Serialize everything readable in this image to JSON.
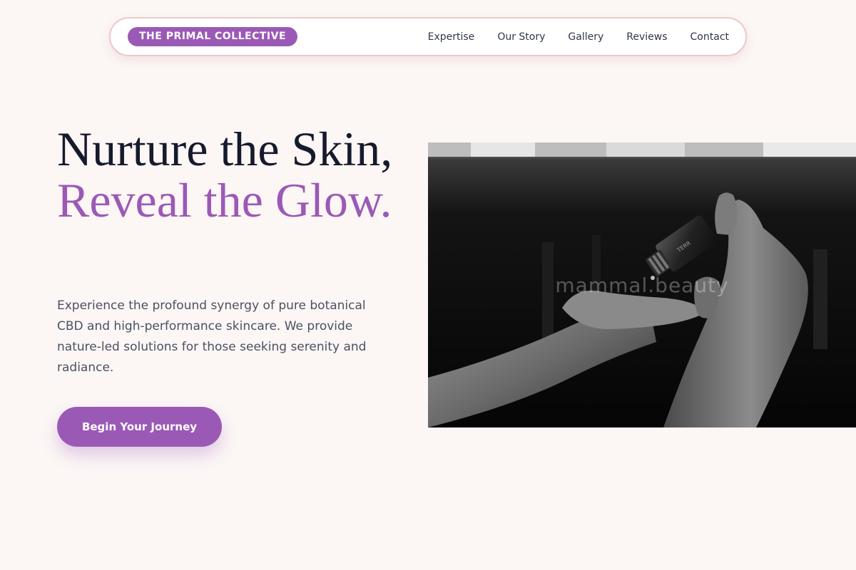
{
  "header": {
    "brand": "THE PRIMAL COLLECTIVE",
    "nav": [
      "Expertise",
      "Our Story",
      "Gallery",
      "Reviews",
      "Contact"
    ]
  },
  "hero": {
    "headline_dark": "Nurture the Skin, ",
    "headline_accent": "Reveal the Glow.",
    "description": "Experience the profound synergy of pure botanical CBD and high-performance skincare. We provide nature-led solutions for those seeking serenity and radiance.",
    "cta_label": "Begin Your Journey"
  },
  "photo": {
    "watermark": "mammal.beauty",
    "bottle_label": "TERR"
  },
  "colors": {
    "accent": "#9b59b6",
    "background": "#fcf6f5",
    "nav_border": "#ecc9c7",
    "heading": "#151a2d",
    "body_text": "#4a5163"
  }
}
